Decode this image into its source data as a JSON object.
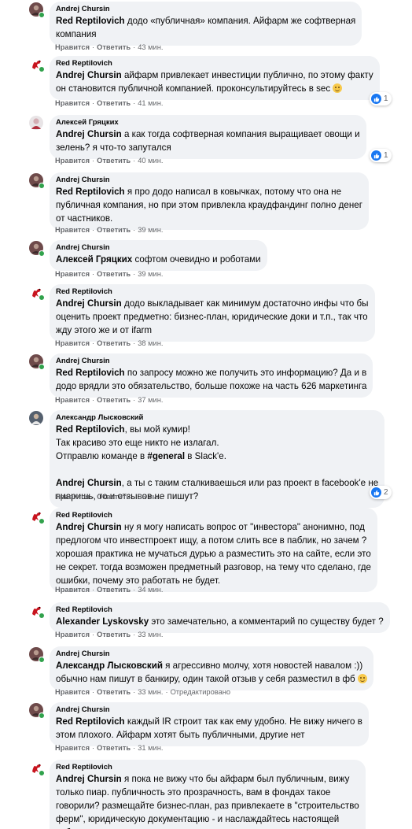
{
  "labels": {
    "like": "Нравится",
    "reply": "Ответить",
    "edited": "Отредактировано",
    "separator": "·"
  },
  "comments": [
    {
      "author": "Andrej Chursin",
      "avatar": "andrej-avatar",
      "online": true,
      "mention": "Red Reptilovich",
      "text": " додо «публичная» компания. Айфарм же софтверная\nкомпания",
      "time": "43 мин.",
      "edited": false
    },
    {
      "author": "Red Reptilovich",
      "avatar": "red-avatar",
      "online": true,
      "mention": "Andrej Chursin",
      "text": " айфарм привлекает инвестиции публично, по этому факту\nон становится публичной компанией. проконсультируйтесь в sec",
      "emoji": "grinning-emoji",
      "time": "41 мин.",
      "reaction_count": "1",
      "edited": false
    },
    {
      "author": "Алексей Гряцких",
      "avatar": "aleksey-avatar",
      "online": false,
      "mention": "Andrej Chursin",
      "text": " а как тогда софтверная компания выращивает овощи и\nзелень? я что-то запутался",
      "time": "40 мин.",
      "reaction_count": "1",
      "edited": false
    },
    {
      "author": "Andrej Chursin",
      "avatar": "andrej-avatar",
      "online": true,
      "mention": "Red Reptilovich",
      "text": " я про додо написал в ковычках, потому что она не\nпубличная компания, но при этом привлекла краудфандинг полно денег\nот частников.",
      "time": "39 мин.",
      "edited": false
    },
    {
      "author": "Andrej Chursin",
      "avatar": "andrej-avatar",
      "online": true,
      "mention": "Алексей Гряцких",
      "text": " софтом очевидно и роботами",
      "time": "39 мин.",
      "edited": false
    },
    {
      "author": "Red Reptilovich",
      "avatar": "red-avatar",
      "online": true,
      "mention": "Andrej Chursin",
      "text": " додо выкладывает как минимум достаточно инфы что бы\nоценить проект предметно: бизнес-план, юридические доки и т.п., так что\nжду этого же и от ifarm",
      "time": "38 мин.",
      "edited": false
    },
    {
      "author": "Andrej Chursin",
      "avatar": "andrej-avatar",
      "online": true,
      "mention": "Red Reptilovich",
      "text": " по запросу можно же получить это информацию? Да и в\nдодо врядли это обязательство, больше похоже на часть 626 маркетинга",
      "time": "37 мин.",
      "edited": false
    },
    {
      "author": "Александр Лысковский",
      "avatar": "aleksandr-avatar",
      "online": false,
      "mention": "Red Reptilovich",
      "text": ", вы мой кумир!\nТак красиво это еще никто не излагал.\nОтправлю команде в ",
      "hashtag": "#general",
      "text_after": " в Slack'е.",
      "mention2": "Andrej Chursin",
      "text2": ", а ты с таким сталкиваешься или раз проект в facebook'е не\nпиаришь, то и отзывов не пишут?",
      "time": "36 мин.",
      "reaction_count": "2",
      "edited": false
    },
    {
      "author": "Red Reptilovich",
      "avatar": "red-avatar",
      "online": true,
      "mention": "Andrej Chursin",
      "text": " ну я могу написать вопрос от \"инвестора\" анонимно, под\nпредлогом что инвестпроект ищу, а потом слить все в паблик, но зачем ?\nхорошая практика не мучаться дурью а разместить это на сайте, если это\nне секрет. тогда возможен предметный разговор, на тему что сделано, где\nошибки, почему это работать не будет.",
      "time": "34 мин.",
      "edited": false
    },
    {
      "author": "Red Reptilovich",
      "avatar": "red-avatar",
      "online": true,
      "mention": "Alexander Lyskovsky",
      "text": " это замечательно, а комментарий по существу будет ?",
      "time": "33 мин.",
      "edited": false
    },
    {
      "author": "Andrej Chursin",
      "avatar": "andrej-avatar",
      "online": true,
      "mention": "Александр Лысковский",
      "text": " я агрессивно молчу, хотя новостей навалом :))\nобычно нам пишут в банкиру, один такой отзыв у себя разместил в фб",
      "emoji": "smiling-emoji",
      "time": "33 мин.",
      "edited": true
    },
    {
      "author": "Andrej Chursin",
      "avatar": "andrej-avatar",
      "online": true,
      "mention": "Red Reptilovich",
      "text": " каждый IR строит так как ему удобно. Не вижу ничего в\nэтом плохого. Айфарм хотят быть публичными, другие нет",
      "time": "31 мин.",
      "edited": false
    },
    {
      "author": "Red Reptilovich",
      "avatar": "red-avatar",
      "online": true,
      "mention": "Andrej Chursin",
      "text": " я пока не вижу что бы айфарм был публичным, вижу\nтолько пиар. публичность это прозрачность, вам в фондах такое\nговорили? размещайте бизнес-план, раз привлекаете в \"строительство\nферм\", юридическую документацию - и наслаждайтесь настоящей\nпубличностью",
      "time": "",
      "edited": false
    }
  ]
}
